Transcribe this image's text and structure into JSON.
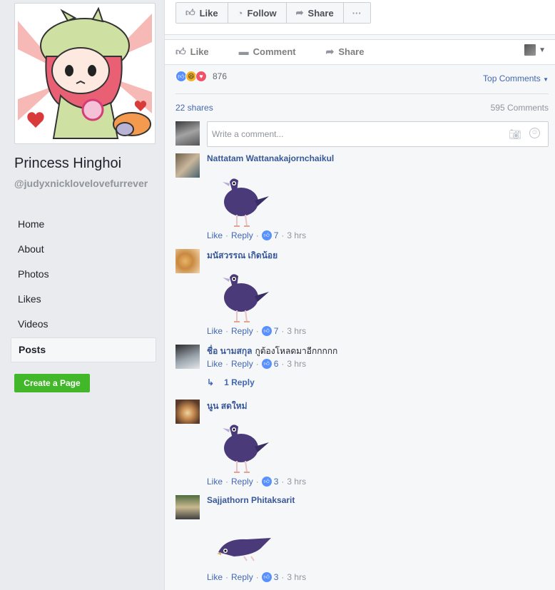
{
  "page": {
    "name": "Princess Hinghoi",
    "handle": "@judyxnicklovelovefurrever"
  },
  "nav": [
    {
      "label": "Home"
    },
    {
      "label": "About"
    },
    {
      "label": "Photos"
    },
    {
      "label": "Likes"
    },
    {
      "label": "Videos"
    },
    {
      "label": "Posts",
      "active": true
    }
  ],
  "create_page_label": "Create a Page",
  "topbar": {
    "like": "Like",
    "follow": "Follow",
    "share": "Share",
    "more": "···"
  },
  "actions": {
    "like": "Like",
    "comment": "Comment",
    "share": "Share"
  },
  "reactions": {
    "count": "876",
    "types": [
      "like",
      "haha",
      "love"
    ]
  },
  "sort_label": "Top Comments",
  "shares": "22 shares",
  "comment_count": "595 Comments",
  "compose": {
    "placeholder": "Write a comment..."
  },
  "comments": [
    {
      "name": "Nattatam Wattanakajornchaikul",
      "text": "",
      "sticker": "bird-walking",
      "likes": "7",
      "time": "3 hrs"
    },
    {
      "name": "มนัสวรรณ เกิดน้อย",
      "text": "",
      "sticker": "bird-walking",
      "likes": "7",
      "time": "3 hrs"
    },
    {
      "name": "ชื่อ นามสกุล",
      "text": "กูต้องโหลดมาอีกกกกก",
      "sticker": "",
      "likes": "6",
      "time": "3 hrs",
      "replies": "1 Reply"
    },
    {
      "name": "นูน สดใหม่",
      "text": "",
      "sticker": "bird-walking",
      "likes": "3",
      "time": "3 hrs"
    },
    {
      "name": "Sajjathorn Phitaksarit",
      "text": "",
      "sticker": "bird-lying",
      "likes": "3",
      "time": "3 hrs"
    }
  ],
  "meta": {
    "like": "Like",
    "reply": "Reply"
  },
  "colors": {
    "link": "#4267b2",
    "green": "#42b72a",
    "bird": "#4a3a7a"
  }
}
